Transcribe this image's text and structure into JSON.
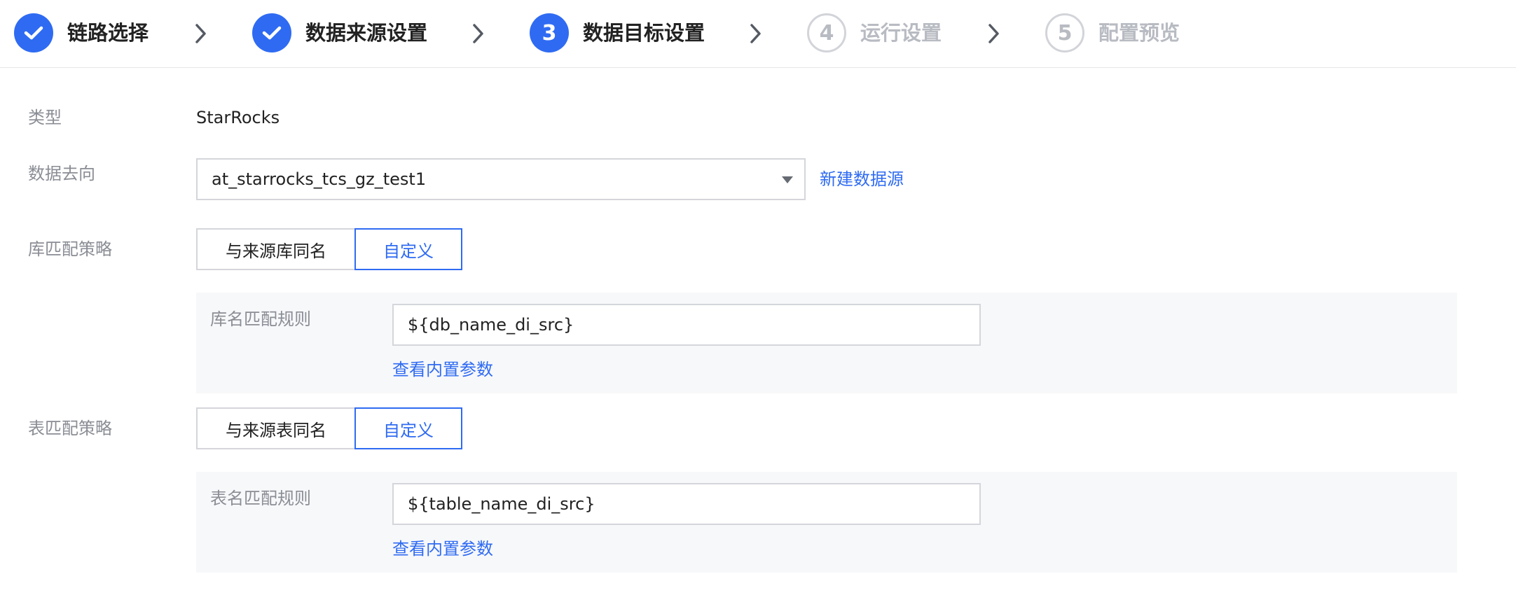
{
  "steps": [
    {
      "label": "链路选择",
      "state": "done",
      "marker": ""
    },
    {
      "label": "数据来源设置",
      "state": "done",
      "marker": ""
    },
    {
      "label": "数据目标设置",
      "state": "active",
      "marker": "3"
    },
    {
      "label": "运行设置",
      "state": "todo",
      "marker": "4"
    },
    {
      "label": "配置预览",
      "state": "todo",
      "marker": "5"
    }
  ],
  "icons": {
    "done": "check-icon",
    "separator": "chevron-right-icon",
    "dropdown": "caret-down-icon"
  },
  "colors": {
    "accent": "#2f6bf2",
    "label": "#8a8d94",
    "inactive_step": "#b8bbc2",
    "panel_bg": "#f7f8fa"
  },
  "form": {
    "type": {
      "label": "类型",
      "value": "StarRocks"
    },
    "destination": {
      "label": "数据去向",
      "value": "at_starrocks_tcs_gz_test1",
      "new_link": "新建数据源"
    },
    "db_strategy": {
      "label": "库匹配策略",
      "options": [
        "与来源库同名",
        "自定义"
      ],
      "selected": "自定义",
      "rule_label": "库名匹配规则",
      "rule_value": "${db_name_di_src}",
      "params_link": "查看内置参数"
    },
    "table_strategy": {
      "label": "表匹配策略",
      "options": [
        "与来源表同名",
        "自定义"
      ],
      "selected": "自定义",
      "rule_label": "表名匹配规则",
      "rule_value": "${table_name_di_src}",
      "params_link": "查看内置参数"
    }
  }
}
